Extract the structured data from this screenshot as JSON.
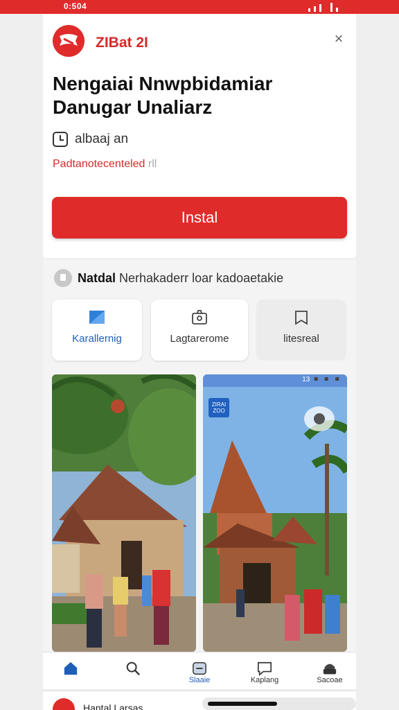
{
  "status_bar": {
    "time": "0:504"
  },
  "header": {
    "brand": "ZIBat 2I",
    "close_symbol": "×"
  },
  "app": {
    "title": "Nengaiai Nnwpbidamiar Danugar Unaliarz",
    "time": "albaaj an",
    "publisher": "Padtanotecenteled",
    "publisher_suffix": " rll",
    "install_label": "Instal"
  },
  "info": {
    "bold": "Natdal",
    "text": " Nerhakaderr loar kadoaetakie"
  },
  "chips": [
    {
      "label": "Karallernig",
      "icon": "flag-icon"
    },
    {
      "label": "Lagtarerome",
      "icon": "photo-icon"
    },
    {
      "label": "litesreal",
      "icon": "bookmark-icon"
    }
  ],
  "screenshot2": {
    "status_text": "13 ◾ ◾ ◾",
    "badge": "ZIRAI ZOO"
  },
  "nav": [
    {
      "label": "",
      "icon": "home-icon"
    },
    {
      "label": "",
      "icon": "search-icon"
    },
    {
      "label": "Slaaie",
      "icon": "app-icon"
    },
    {
      "label": "Kaplang",
      "icon": "chat-icon"
    },
    {
      "label": "Sacoae",
      "icon": "profile-icon"
    }
  ],
  "peek": {
    "text": "Hantal   Larsas"
  },
  "colors": {
    "accent": "#e02b2b",
    "link": "#1e5eb8"
  }
}
